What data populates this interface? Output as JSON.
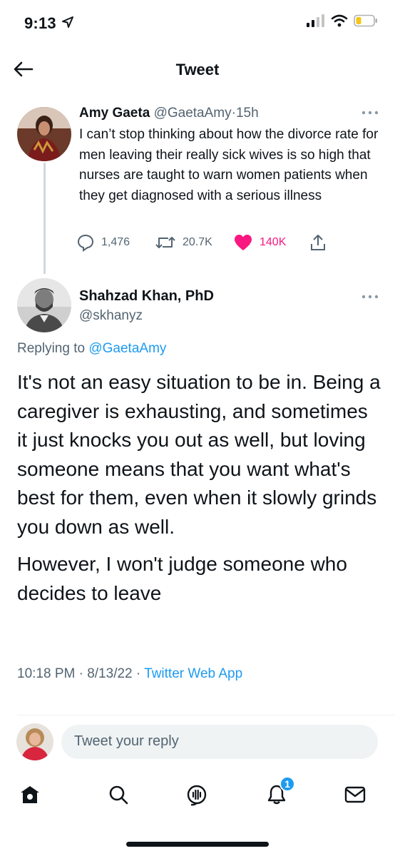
{
  "status_bar": {
    "time": "9:13"
  },
  "header": {
    "title": "Tweet"
  },
  "parent_tweet": {
    "name": "Amy Gaeta",
    "handle": "@GaetaAmy",
    "separator": "·",
    "time": "15h",
    "text": "I can’t stop thinking about how the divorce rate for men leaving their really sick wives is so high that nurses are taught to warn women patients when they get diagnosed with a serious illness",
    "replies": "1,476",
    "retweets": "20.7K",
    "likes": "140K",
    "like_color": "#f91880"
  },
  "reply_tweet": {
    "name": "Shahzad Khan, PhD",
    "handle": "@skhanyz",
    "replying_prefix": "Replying to ",
    "replying_to": "@GaetaAmy",
    "paragraph_1": "It's not an easy situation to be in. Being a caregiver is exhausting, and sometimes it just knocks you out as well, but loving someone means that you want what's best for them, even when it slowly grinds you down as well.",
    "paragraph_2": "However, I won't judge someone who decides to leave",
    "timestamp": "10:18 PM · 8/13/22 · ",
    "source": "Twitter Web App"
  },
  "composer": {
    "placeholder": "Tweet your reply"
  },
  "bottom_nav": {
    "notifications_badge": "1"
  },
  "colors": {
    "accent": "#1d9bf0",
    "like": "#f91880",
    "text": "#0f1419",
    "muted": "#536471"
  }
}
